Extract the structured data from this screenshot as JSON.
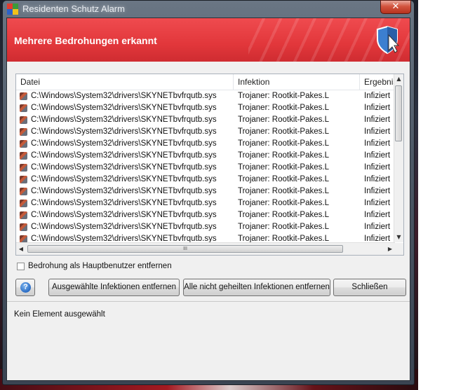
{
  "window": {
    "title": "Residenten Schutz Alarm",
    "close_symbol": "✕"
  },
  "header": {
    "title": "Mehrere Bedrohungen erkannt",
    "icon": "shield-cursor-icon",
    "color": "#e2373b"
  },
  "table": {
    "columns": [
      "Datei",
      "Infektion",
      "Ergebnis"
    ],
    "rows": [
      {
        "file": "C:\\Windows\\System32\\drivers\\SKYNETbvfrqutb.sys",
        "infection": "Trojaner: Rootkit-Pakes.L",
        "result": "Infiziert"
      },
      {
        "file": "C:\\Windows\\System32\\drivers\\SKYNETbvfrqutb.sys",
        "infection": "Trojaner: Rootkit-Pakes.L",
        "result": "Infiziert"
      },
      {
        "file": "C:\\Windows\\System32\\drivers\\SKYNETbvfrqutb.sys",
        "infection": "Trojaner: Rootkit-Pakes.L",
        "result": "Infiziert"
      },
      {
        "file": "C:\\Windows\\System32\\drivers\\SKYNETbvfrqutb.sys",
        "infection": "Trojaner: Rootkit-Pakes.L",
        "result": "Infiziert"
      },
      {
        "file": "C:\\Windows\\System32\\drivers\\SKYNETbvfrqutb.sys",
        "infection": "Trojaner: Rootkit-Pakes.L",
        "result": "Infiziert"
      },
      {
        "file": "C:\\Windows\\System32\\drivers\\SKYNETbvfrqutb.sys",
        "infection": "Trojaner: Rootkit-Pakes.L",
        "result": "Infiziert"
      },
      {
        "file": "C:\\Windows\\System32\\drivers\\SKYNETbvfrqutb.sys",
        "infection": "Trojaner: Rootkit-Pakes.L",
        "result": "Infiziert"
      },
      {
        "file": "C:\\Windows\\System32\\drivers\\SKYNETbvfrqutb.sys",
        "infection": "Trojaner: Rootkit-Pakes.L",
        "result": "Infiziert"
      },
      {
        "file": "C:\\Windows\\System32\\drivers\\SKYNETbvfrqutb.sys",
        "infection": "Trojaner: Rootkit-Pakes.L",
        "result": "Infiziert"
      },
      {
        "file": "C:\\Windows\\System32\\drivers\\SKYNETbvfrqutb.sys",
        "infection": "Trojaner: Rootkit-Pakes.L",
        "result": "Infiziert"
      },
      {
        "file": "C:\\Windows\\System32\\drivers\\SKYNETbvfrqutb.sys",
        "infection": "Trojaner: Rootkit-Pakes.L",
        "result": "Infiziert"
      },
      {
        "file": "C:\\Windows\\System32\\drivers\\SKYNETbvfrqutb.sys",
        "infection": "Trojaner: Rootkit-Pakes.L",
        "result": "Infiziert"
      },
      {
        "file": "C:\\Windows\\System32\\drivers\\SKYNETbvfrqutb.sys",
        "infection": "Trojaner: Rootkit-Pakes.L",
        "result": "Infiziert"
      }
    ],
    "row_icon": "virus-file-icon",
    "hscroll_grip": "III"
  },
  "checkbox": {
    "label": "Bedrohung als Hauptbenutzer entfernen",
    "checked": false
  },
  "buttons": {
    "help": "?",
    "remove_selected": "Ausgewählte Infektionen entfernen",
    "remove_all": "Alle nicht geheilten Infektionen entfernen",
    "close": "Schließen"
  },
  "status": {
    "text": "Kein Element ausgewählt"
  }
}
